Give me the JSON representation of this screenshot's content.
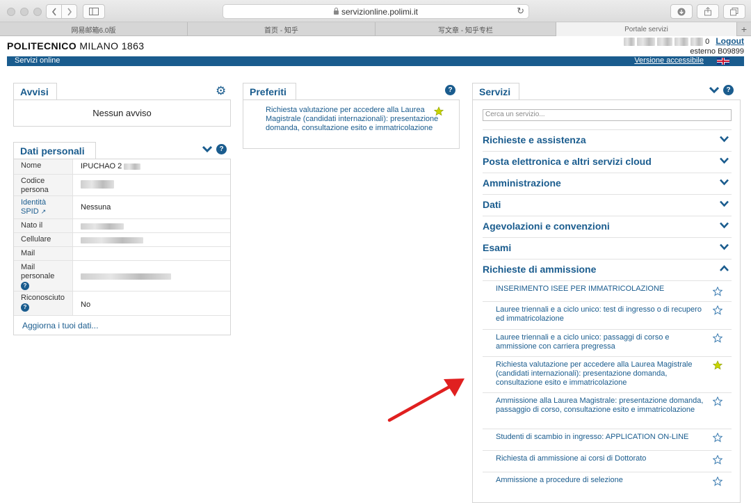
{
  "browser": {
    "url": "servizionline.polimi.it",
    "tabs": [
      "网易邮箱6.0版",
      "首页 - 知乎",
      "写文章 - 知乎专栏",
      "Portale servizi"
    ],
    "active_tab": 3,
    "new_tab": "+"
  },
  "header": {
    "brand_bold": "POLITECNICO",
    "brand_rest": " MILANO 1863",
    "user_suffix": "0",
    "logout": "Logout",
    "user_id": "esterno B09899"
  },
  "bar": {
    "left": "Servizi online",
    "right": "Versione accessibile"
  },
  "avvisi": {
    "title": "Avvisi",
    "empty": "Nessun avviso",
    "icon": "gear-icon"
  },
  "dati": {
    "title": "Dati personali",
    "rows": [
      {
        "key": "Nome",
        "value": "IPUCHAO 2"
      },
      {
        "key": "Codice persona",
        "value": ""
      },
      {
        "key": "Identità SPID",
        "value": "Nessuna"
      },
      {
        "key": "Nato il",
        "value": ""
      },
      {
        "key": "Cellulare",
        "value": ""
      },
      {
        "key": "Mail",
        "value": ""
      },
      {
        "key": "Mail personale",
        "value": ""
      },
      {
        "key": "Riconosciuto",
        "value": "No"
      }
    ],
    "update": "Aggiorna i tuoi dati..."
  },
  "preferiti": {
    "title": "Preferiti",
    "items": [
      "Richiesta valutazione per accedere alla Laurea Magistrale (candidati internazionali): presentazione domanda, consultazione esito e immatricolazione"
    ]
  },
  "servizi": {
    "title": "Servizi",
    "search_placeholder": "Cerca un servizio...",
    "categories": [
      "Richieste e assistenza",
      "Posta elettronica e altri servizi cloud",
      "Amministrazione",
      "Dati",
      "Agevolazioni e convenzioni",
      "Esami",
      "Richieste di ammissione"
    ],
    "expanded_category": "Richieste di ammissione",
    "subitems": [
      {
        "text": "INSERIMENTO ISEE PER IMMATRICOLAZIONE",
        "favorite": false
      },
      {
        "text": "Lauree triennali e a ciclo unico: test di ingresso o di recupero ed immatricolazione",
        "favorite": false
      },
      {
        "text": "Lauree triennali e a ciclo unico: passaggi di corso e ammissione con carriera pregressa",
        "favorite": false
      },
      {
        "text": "Richiesta valutazione per accedere alla Laurea Magistrale (candidati internazionali): presentazione domanda, consultazione esito e immatricolazione",
        "favorite": true
      },
      {
        "text": "Ammissione alla Laurea Magistrale: presentazione domanda, passaggio di corso, consultazione esito e immatricolazione",
        "favorite": false
      },
      {
        "text": "Studenti di scambio in ingresso: APPLICATION ON-LINE",
        "favorite": false
      },
      {
        "text": "Richiesta di ammissione ai corsi di Dottorato",
        "favorite": false
      },
      {
        "text": "Ammissione a procedure di selezione",
        "favorite": false
      }
    ]
  },
  "colors": {
    "accent": "#1a5c8e",
    "star_active": "#c8d400",
    "arrow": "#e02020"
  }
}
